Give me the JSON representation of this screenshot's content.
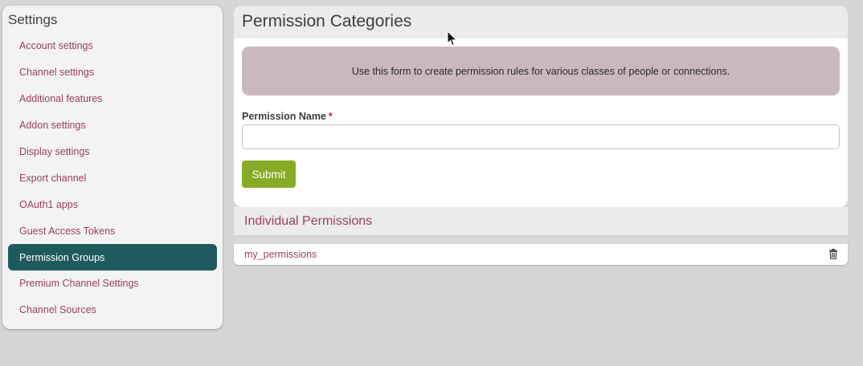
{
  "sidebar": {
    "title": "Settings",
    "items": [
      {
        "label": "Account settings"
      },
      {
        "label": "Channel settings"
      },
      {
        "label": "Additional features"
      },
      {
        "label": "Addon settings"
      },
      {
        "label": "Display settings"
      },
      {
        "label": "Export channel"
      },
      {
        "label": "OAuth1 apps"
      },
      {
        "label": "Guest Access Tokens"
      },
      {
        "label": "Permission Groups",
        "active": true
      },
      {
        "label": "Premium Channel Settings"
      },
      {
        "label": "Channel Sources"
      }
    ]
  },
  "main": {
    "title": "Permission Categories",
    "info_text": "Use this form to create permission rules for various classes of people or connections.",
    "field_label": "Permission Name",
    "required_marker": "*",
    "input_value": "",
    "submit_label": "Submit",
    "section_title": "Individual Permissions",
    "permissions": [
      {
        "name": "my_permissions"
      }
    ]
  },
  "icons": {
    "delete": "trash-icon",
    "pointer": "mouse-cursor-icon"
  },
  "colors": {
    "accent": "#9b3f62",
    "active_nav": "#1f5b5e",
    "submit": "#86ab26",
    "info_box": "#cbb8be"
  }
}
